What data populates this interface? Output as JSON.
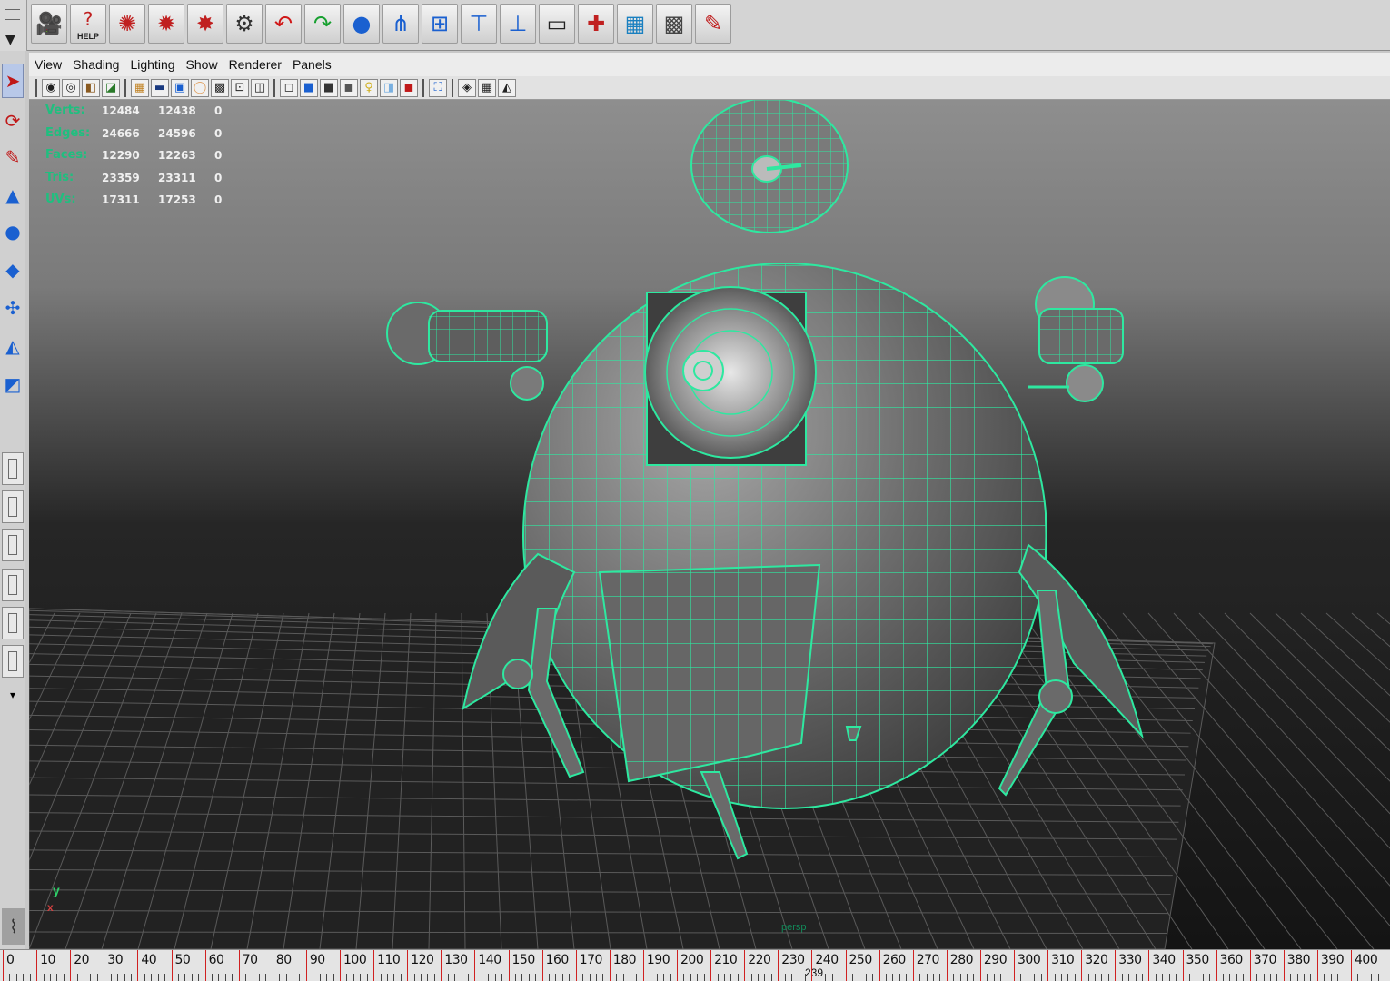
{
  "shelf": {
    "help_label": "HELP",
    "icons": [
      "render-camera-icon",
      "help-icon",
      "render-view-icon",
      "render-current-icon",
      "ipr-render-icon",
      "batch-render-icon",
      "undo-arrow-icon",
      "redo-arrow-icon",
      "sphere-icon",
      "hierarchy-icon",
      "group-icon",
      "parent-icon",
      "unparent-icon",
      "script-editor-icon",
      "hypershade-icon",
      "outliner-icon",
      "texture-icon",
      "paint-icon"
    ]
  },
  "menu": {
    "items": [
      "View",
      "Shading",
      "Lighting",
      "Show",
      "Renderer",
      "Panels"
    ]
  },
  "hud": {
    "rows": [
      {
        "label": "Verts:",
        "a": "12484",
        "b": "12438",
        "c": "0"
      },
      {
        "label": "Edges:",
        "a": "24666",
        "b": "24596",
        "c": "0"
      },
      {
        "label": "Faces:",
        "a": "12290",
        "b": "12263",
        "c": "0"
      },
      {
        "label": "Tris:",
        "a": "23359",
        "b": "23311",
        "c": "0"
      },
      {
        "label": "UVs:",
        "a": "17311",
        "b": "17253",
        "c": "0"
      }
    ]
  },
  "viewport": {
    "camera": "persp",
    "axis_y": "y",
    "axis_x": "x",
    "wire_color": "#2ee8a0",
    "mesh_color": "#6c6c6c"
  },
  "timeline": {
    "labels": [
      "0",
      "10",
      "20",
      "30",
      "40",
      "50",
      "60",
      "70",
      "80",
      "90",
      "100",
      "110",
      "120",
      "130",
      "140",
      "150",
      "160",
      "170",
      "180",
      "190",
      "200",
      "210",
      "220",
      "230",
      "240",
      "250",
      "260",
      "270",
      "280",
      "290",
      "300",
      "310",
      "320",
      "330",
      "340",
      "350",
      "360",
      "370",
      "380",
      "390",
      "400"
    ],
    "current_frame": "239"
  }
}
